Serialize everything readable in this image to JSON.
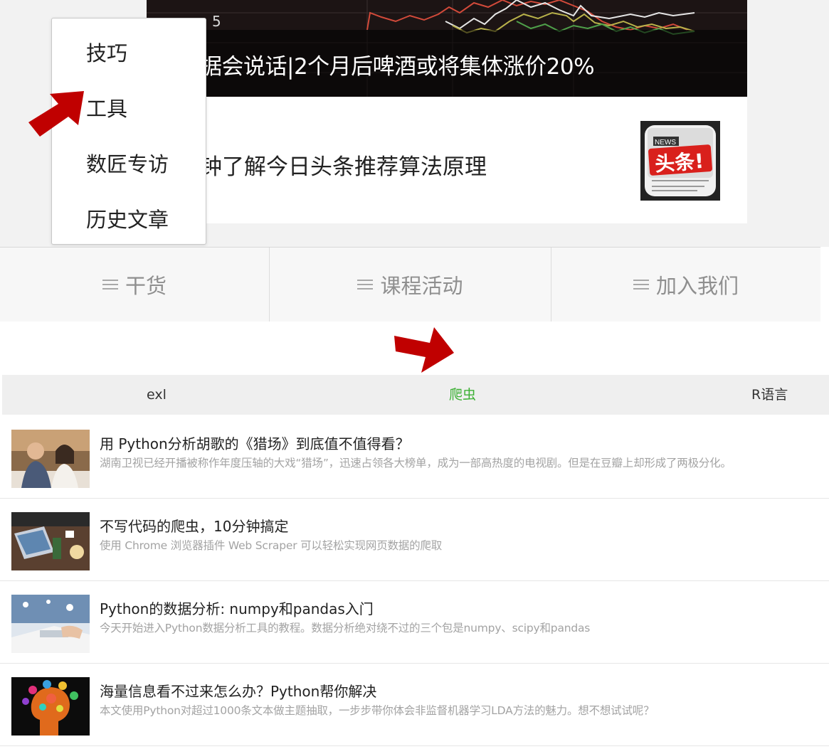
{
  "banner": {
    "axis_number": "5",
    "title": "据会说话|2个月后啤酒或将集体涨价20%"
  },
  "article": {
    "title": "钟了解今日头条推荐算法原理",
    "thumb_label_top": "NEWS",
    "thumb_label_main": "头条!"
  },
  "dropdown": {
    "items": [
      {
        "label": "技巧"
      },
      {
        "label": "工具"
      },
      {
        "label": "数匠专访"
      },
      {
        "label": "历史文章"
      }
    ]
  },
  "tabs": [
    {
      "label": "干货",
      "icon": "menu-icon"
    },
    {
      "label": "课程活动",
      "icon": "menu-icon"
    },
    {
      "label": "加入我们",
      "icon": "menu-icon"
    }
  ],
  "categories": [
    {
      "label": "exl"
    },
    {
      "label": "爬虫"
    },
    {
      "label": "R语言"
    }
  ],
  "active_color": "#3cb034",
  "arrow_color": "#c00000",
  "articles": [
    {
      "title": "用 Python分析胡歌的《猎场》到底值不值得看？",
      "desc": "湖南卫视已经开播被称作年度压轴的大戏“猎场”，迅速占领各大榜单，成为一部高热度的电视剧。但是在豆瓣上却形成了两极分化。"
    },
    {
      "title": "不写代码的爬虫，10分钟搞定",
      "desc": "使用 Chrome 浏览器插件 Web Scraper 可以轻松实现网页数据的爬取"
    },
    {
      "title": "Python的数据分析: numpy和pandas入门",
      "desc": "今天开始进入Python数据分析工具的教程。数据分析绝对绕不过的三个包是numpy、scipy和pandas"
    },
    {
      "title": "海量信息看不过来怎么办？Python帮你解决",
      "desc": "本文使用Python对超过1000条文本做主题抽取，一步步带你体会非监督机器学习LDA方法的魅力。想不想试试呢？"
    }
  ]
}
